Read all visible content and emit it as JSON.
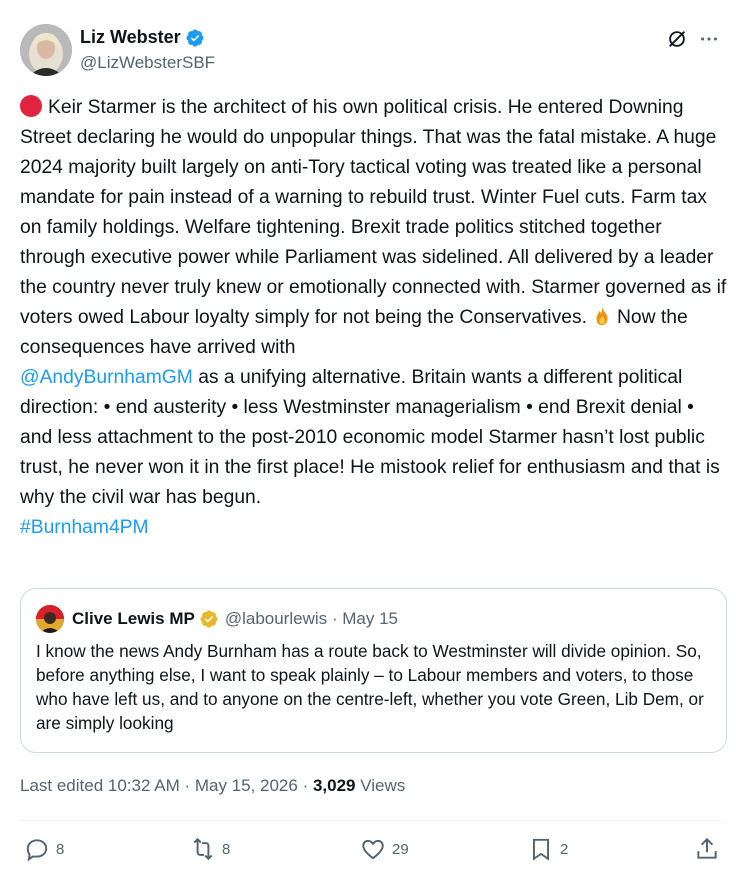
{
  "author": {
    "name": "Liz Webster",
    "handle": "@LizWebsterSBF"
  },
  "tweet": {
    "text_part1": "Keir Starmer is the architect of his own political crisis. He entered Downing Street declaring he would do unpopular things. That was the fatal mistake. A huge 2024 majority built largely on anti-Tory tactical voting was treated like a personal mandate for pain instead of a warning to rebuild trust. Winter Fuel cuts. Farm tax on family holdings. Welfare tightening. Brexit trade politics stitched together through executive power while Parliament was sidelined. All delivered by a leader the country never truly knew or emotionally connected with. Starmer governed as if voters owed Labour loyalty simply for not being the Conservatives.",
    "text_part2": "Now the consequences have arrived with",
    "mention": "@AndyBurnhamGM",
    "text_part3": "as a unifying alternative. Britain wants a different political direction: • end austerity • less Westminster managerialism • end Brexit denial • and less attachment to the post-2010 economic model Starmer hasn’t lost public trust, he never won it in the first place! He mistook relief for enthusiasm and that is why the civil war has begun.",
    "hashtag": "#Burnham4PM"
  },
  "quote": {
    "name": "Clive Lewis MP",
    "handle": "@labourlewis",
    "date": "May 15",
    "text": "I know the news Andy Burnham has a route back to Westminster will divide opinion. So, before anything else, I want to speak plainly – to Labour members and voters, to those who have left us, and to anyone on the centre-left, whether you vote Green, Lib Dem, or are simply looking"
  },
  "meta": {
    "edited": "Last edited 10:32 AM · May 15, 2026 ·",
    "views_count": "3,029",
    "views_label": "Views"
  },
  "actions": {
    "replies": "8",
    "reposts": "8",
    "likes": "29",
    "bookmarks": "2"
  },
  "colors": {
    "accent": "#1d9bf0",
    "muted": "#536471",
    "red_dot": "#e0243d",
    "gold_badge": "#e8b829"
  },
  "icons": [
    "verified-badge-icon",
    "grok-icon",
    "more-icon",
    "red-circle-emoji",
    "fire-emoji",
    "reply-icon",
    "repost-icon",
    "like-icon",
    "bookmark-icon",
    "share-icon"
  ]
}
